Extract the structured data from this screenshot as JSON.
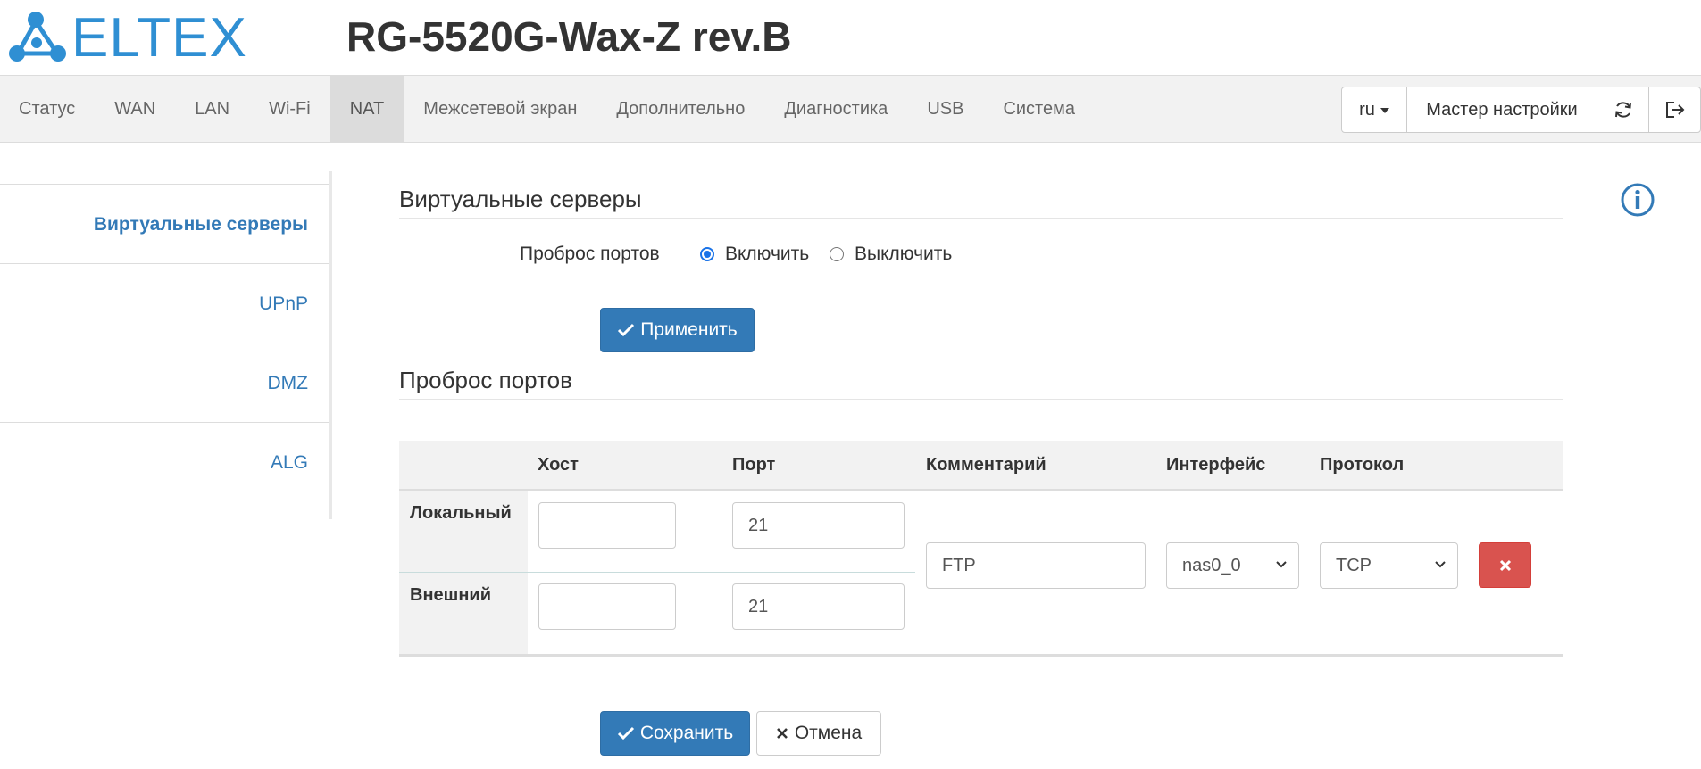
{
  "header": {
    "logo_text": "ELTEX",
    "device_title": "RG-5520G-Wax-Z rev.B"
  },
  "nav": {
    "items": [
      {
        "label": "Статус"
      },
      {
        "label": "WAN"
      },
      {
        "label": "LAN"
      },
      {
        "label": "Wi-Fi"
      },
      {
        "label": "NAT",
        "active": true
      },
      {
        "label": "Межсетевой экран"
      },
      {
        "label": "Дополнительно"
      },
      {
        "label": "Диагностика"
      },
      {
        "label": "USB"
      },
      {
        "label": "Система"
      }
    ],
    "language": "ru",
    "wizard_label": "Мастер настройки"
  },
  "sidebar": {
    "items": [
      {
        "label": "Виртуальные серверы",
        "active": true
      },
      {
        "label": "UPnP"
      },
      {
        "label": "DMZ"
      },
      {
        "label": "ALG"
      }
    ]
  },
  "virtual_servers": {
    "title": "Виртуальные серверы",
    "port_forwarding_label": "Проброс портов",
    "enable_label": "Включить",
    "disable_label": "Выключить",
    "selected": "enable",
    "apply_label": "Применить"
  },
  "port_forwarding": {
    "title": "Проброс портов",
    "columns": {
      "host": "Хост",
      "port": "Порт",
      "comment": "Комментарий",
      "interface": "Интерфейс",
      "protocol": "Протокол"
    },
    "rule": {
      "local_label": "Локальный",
      "external_label": "Внешний",
      "local_host": "",
      "local_port": "21",
      "external_host": "",
      "external_port": "21",
      "comment": "FTP",
      "interface": "nas0_0",
      "protocol": "TCP"
    }
  },
  "footer": {
    "save_label": "Сохранить",
    "cancel_label": "Отмена"
  },
  "colors": {
    "accent": "#337ab7",
    "logo": "#2f8fd3",
    "danger": "#d9534f",
    "nav_bg": "#f2f2f2",
    "nav_active_bg": "#dcdcdc"
  }
}
